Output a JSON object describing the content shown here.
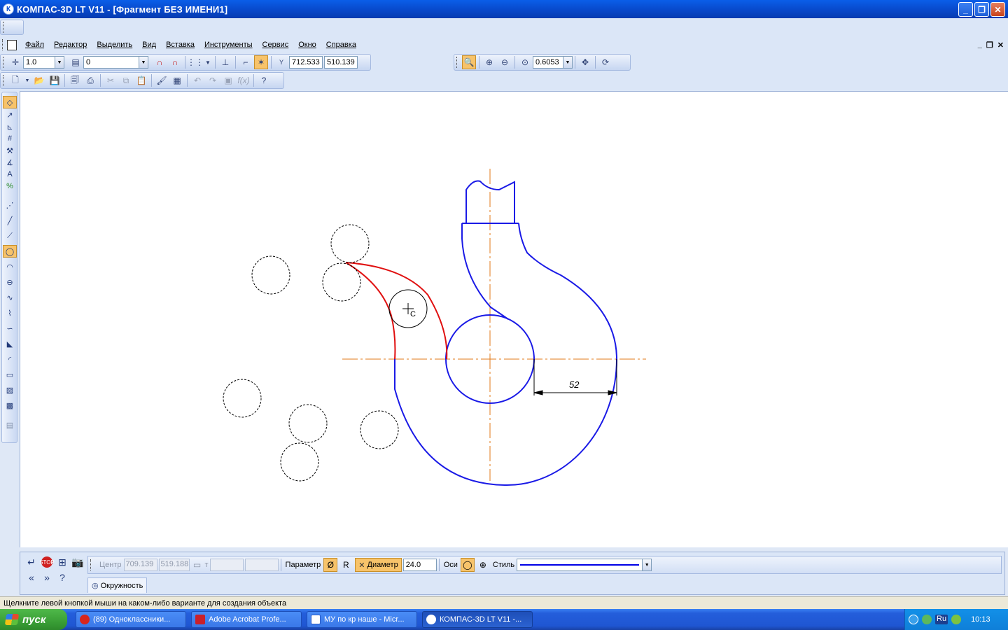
{
  "window": {
    "title": "КОМПАС-3D LT V11 - [Фрагмент БЕЗ ИМЕНИ1]",
    "app_icon": "К",
    "controls": [
      "minimize",
      "restore",
      "close"
    ]
  },
  "menu": {
    "items": [
      "Файл",
      "Редактор",
      "Выделить",
      "Вид",
      "Вставка",
      "Инструменты",
      "Сервис",
      "Окно",
      "Справка"
    ]
  },
  "toolbar_current": {
    "step": "1.0",
    "layer": "0",
    "x_label": "Y",
    "coord_x": "712.533",
    "coord_y": "510.139"
  },
  "toolbar_view": {
    "zoom": "0.6053"
  },
  "drawing": {
    "dimension_text": "52",
    "cursor_label": "C",
    "colors": {
      "contour": "#1a1ae6",
      "highlight": "#e01010",
      "axis": "#e07a1a",
      "phantom": "#000000"
    }
  },
  "property_panel": {
    "center_label": "Центр",
    "center_x": "709.139",
    "center_y": "519.188",
    "point_label": "т",
    "parameter_label": "Параметр",
    "radius_btn": "R",
    "diameter_label": "Диаметр",
    "diameter_value": "24.0",
    "axes_label": "Оси",
    "style_label": "Стиль",
    "tab_label": "Окружность"
  },
  "status": {
    "hint": "Щелкните левой кнопкой мыши на каком-либо варианте для создания объекта"
  },
  "taskbar": {
    "start": "пуск",
    "tasks": [
      {
        "label": "(89) Одноклассники...",
        "color": "#d8261d"
      },
      {
        "label": "Adobe Acrobat Profe...",
        "color": "#c9202a"
      },
      {
        "label": "МУ по кр наше - Micr...",
        "color": "#2a5cc8"
      },
      {
        "label": "КОМПАС-3D LT V11 -...",
        "color": "#2a5cc8"
      }
    ],
    "lang": "RU",
    "tray_lang": "Ru",
    "clock": "10:13"
  }
}
